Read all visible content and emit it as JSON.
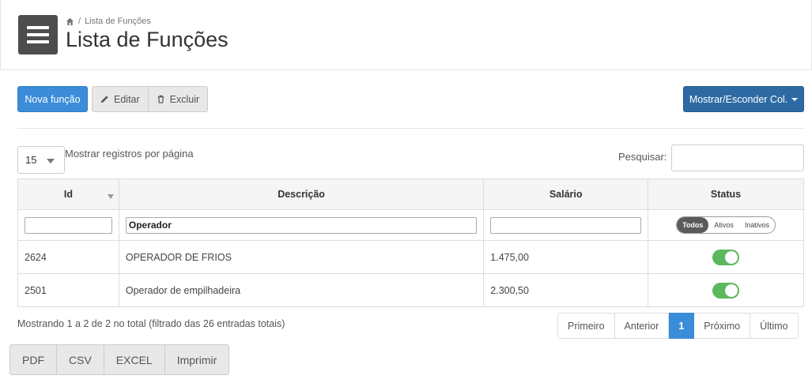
{
  "breadcrumb": {
    "current": "Lista de Funções"
  },
  "page": {
    "title": "Lista de Funções"
  },
  "toolbar": {
    "new_label": "Nova função",
    "edit_label": "Editar",
    "delete_label": "Excluir",
    "columns_label": "Mostrar/Esconder Col."
  },
  "length": {
    "value": "15",
    "label": "Mostrar registros por página"
  },
  "search": {
    "label": "Pesquisar:",
    "value": ""
  },
  "table": {
    "headers": [
      "Id",
      "Descrição",
      "Salário",
      "Status"
    ],
    "filters": {
      "id": "",
      "descricao": "Operador",
      "salario": ""
    },
    "status_filter": [
      "Todos",
      "Ativos",
      "Inativos"
    ],
    "rows": [
      {
        "id": "2624",
        "descricao": "OPERADOR DE FRIOS",
        "salario": "1.475,00",
        "status_on": true
      },
      {
        "id": "2501",
        "descricao": "Operador de empilhadeira",
        "salario": "2.300,50",
        "status_on": true
      }
    ]
  },
  "info": "Mostrando 1 a 2 de 2 no total (filtrado das 26 entradas totais)",
  "pagination": [
    "Primeiro",
    "Anterior",
    "1",
    "Próximo",
    "Último"
  ],
  "export": [
    "PDF",
    "CSV",
    "EXCEL",
    "Imprimir"
  ],
  "colors": {
    "primary": "#3c8dd9",
    "dark_button": "#2d6aa3",
    "toggle_on": "#5cb85c",
    "menu_bg": "#4d4d4d"
  }
}
